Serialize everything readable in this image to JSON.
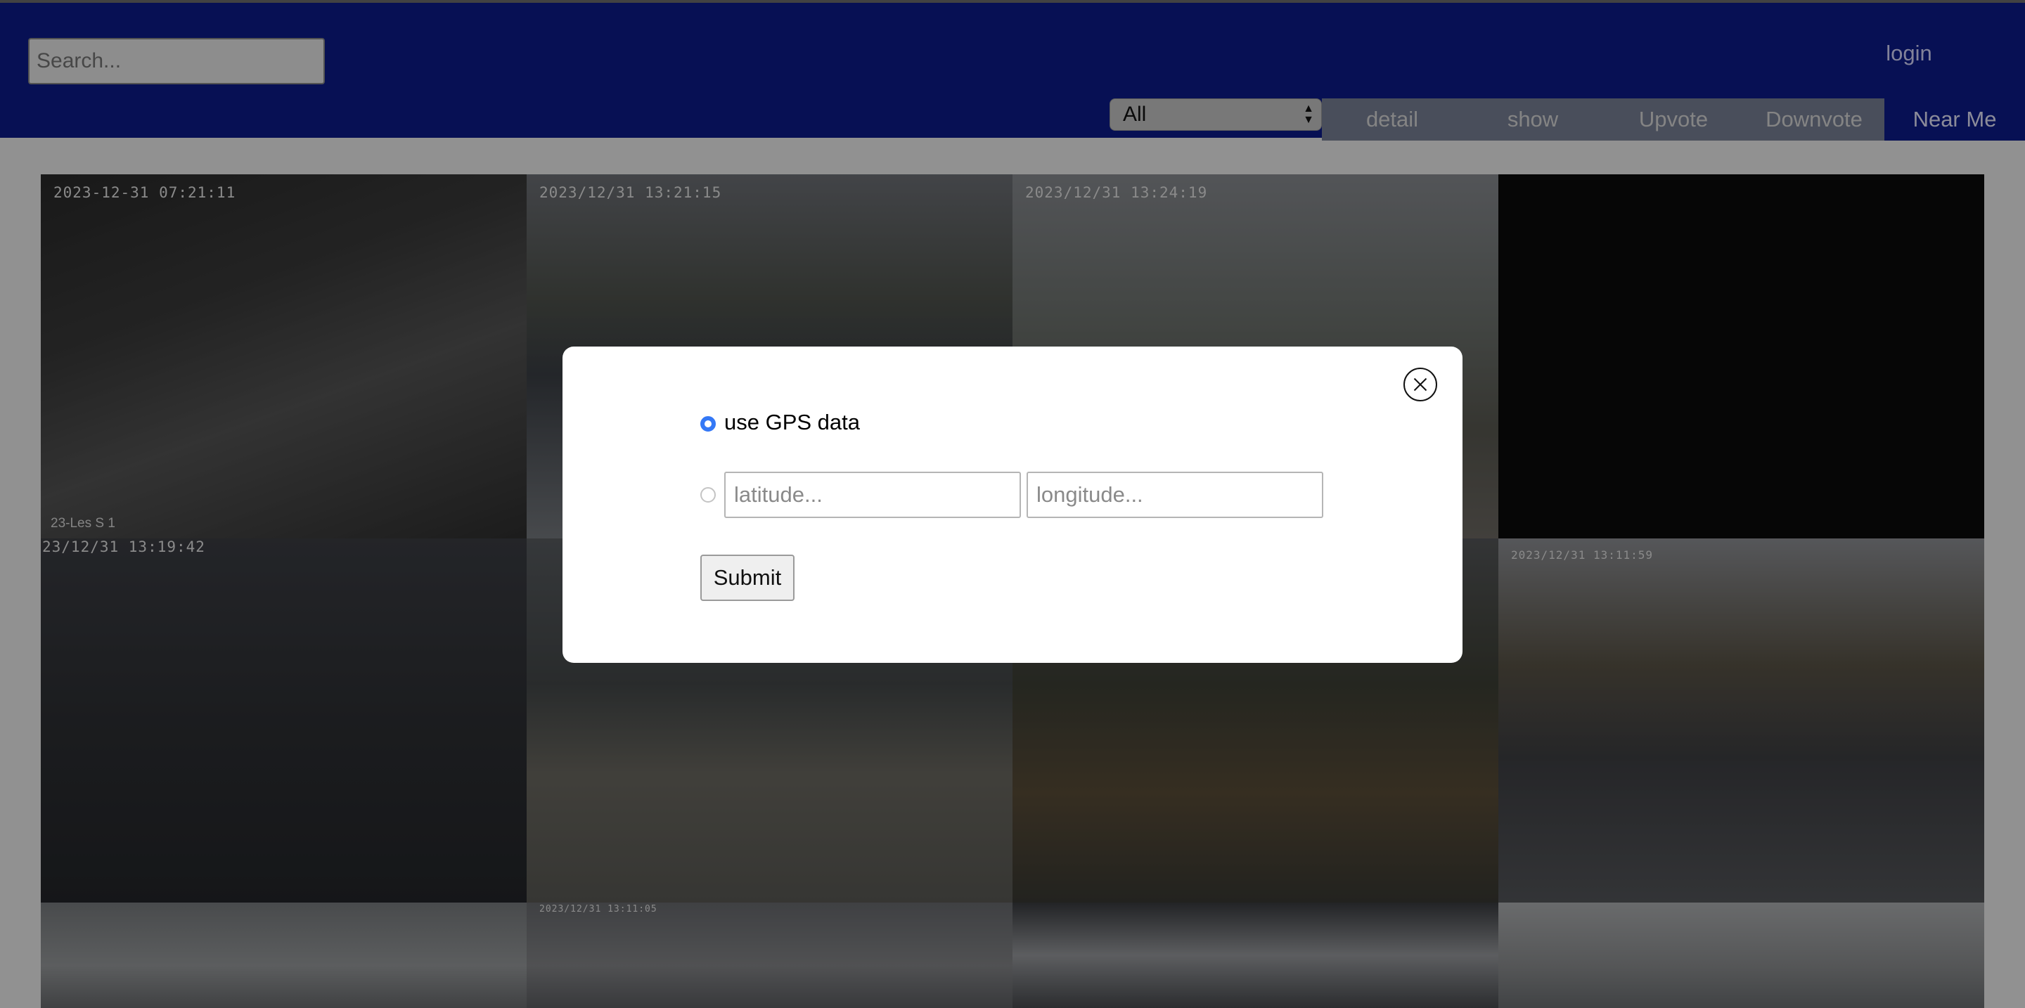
{
  "header": {
    "search_placeholder": "Search...",
    "login_label": "login",
    "filter_select": {
      "selected": "All"
    },
    "nav_tabs": [
      "detail",
      "show",
      "Upvote",
      "Downvote",
      "Near Me"
    ]
  },
  "grid": {
    "cells": [
      {
        "stamp": "2023-12-31 07:21:11",
        "caption": "23-Les S 1",
        "bg": "linear-gradient(160deg,#2a2a2a 0%,#3b3b3b 35%,#555 60%,#2f2f2f 100%)"
      },
      {
        "stamp": "2023/12/31  13:21:15",
        "caption": "",
        "bg": "linear-gradient(180deg,#6f7278 0%,#4f534d 35%,#3c4046 55%,#777b80 100%)"
      },
      {
        "stamp": "2023/12/31  13:24:19",
        "caption": "",
        "bg": "linear-gradient(180deg,#8a8d92 0%,#6f7470 40%,#5a5a52 70%,#6e6a64 100%)"
      },
      {
        "stamp": "",
        "caption": "",
        "bg": "#0a0a0a"
      },
      {
        "stamp": "23/12/31  13:19:42",
        "caption": "",
        "bg": "linear-gradient(180deg,#3c3e44 0%,#2e3034 50%,#24262a 100%)"
      },
      {
        "stamp": "",
        "caption": "",
        "bg": "linear-gradient(180deg,#5a5e62 0%,#45494a 40%,#6c6a62 65%,#5b5b56 100%)"
      },
      {
        "stamp": "",
        "caption": "",
        "bg": "linear-gradient(180deg,#56585a 0%,#3e4036 40%,#5a4d38 70%,#3a3a34 100%)"
      },
      {
        "stamp": "2023/12/31 13:11:59",
        "caption": "",
        "bg": "linear-gradient(180deg,#8f9196 0%,#5a5447 35%,#3f4044 60%,#55575b 100%)"
      },
      {
        "stamp": "",
        "caption": "",
        "bg": "linear-gradient(180deg,#7a7d80 0%,#999c9e 60%,#6b6d70 100%)"
      },
      {
        "stamp": "2023/12/31 13:11:05",
        "caption": "",
        "bg": "linear-gradient(180deg,#6a6c70 0%,#86878a 60%,#5e6064 100%)"
      },
      {
        "stamp": "",
        "caption": "",
        "bg": "linear-gradient(180deg,#3a3c40 0%,#9a9ca0 50%,#4a4c50 100%)"
      },
      {
        "stamp": "",
        "caption": "",
        "bg": "linear-gradient(180deg,#b0b2b4 0%,#8e9092 60%,#6d7073 100%)"
      }
    ]
  },
  "modal": {
    "gps_label": "use GPS data",
    "latitude_placeholder": "latitude...",
    "longitude_placeholder": "longitude...",
    "submit_label": "Submit"
  }
}
